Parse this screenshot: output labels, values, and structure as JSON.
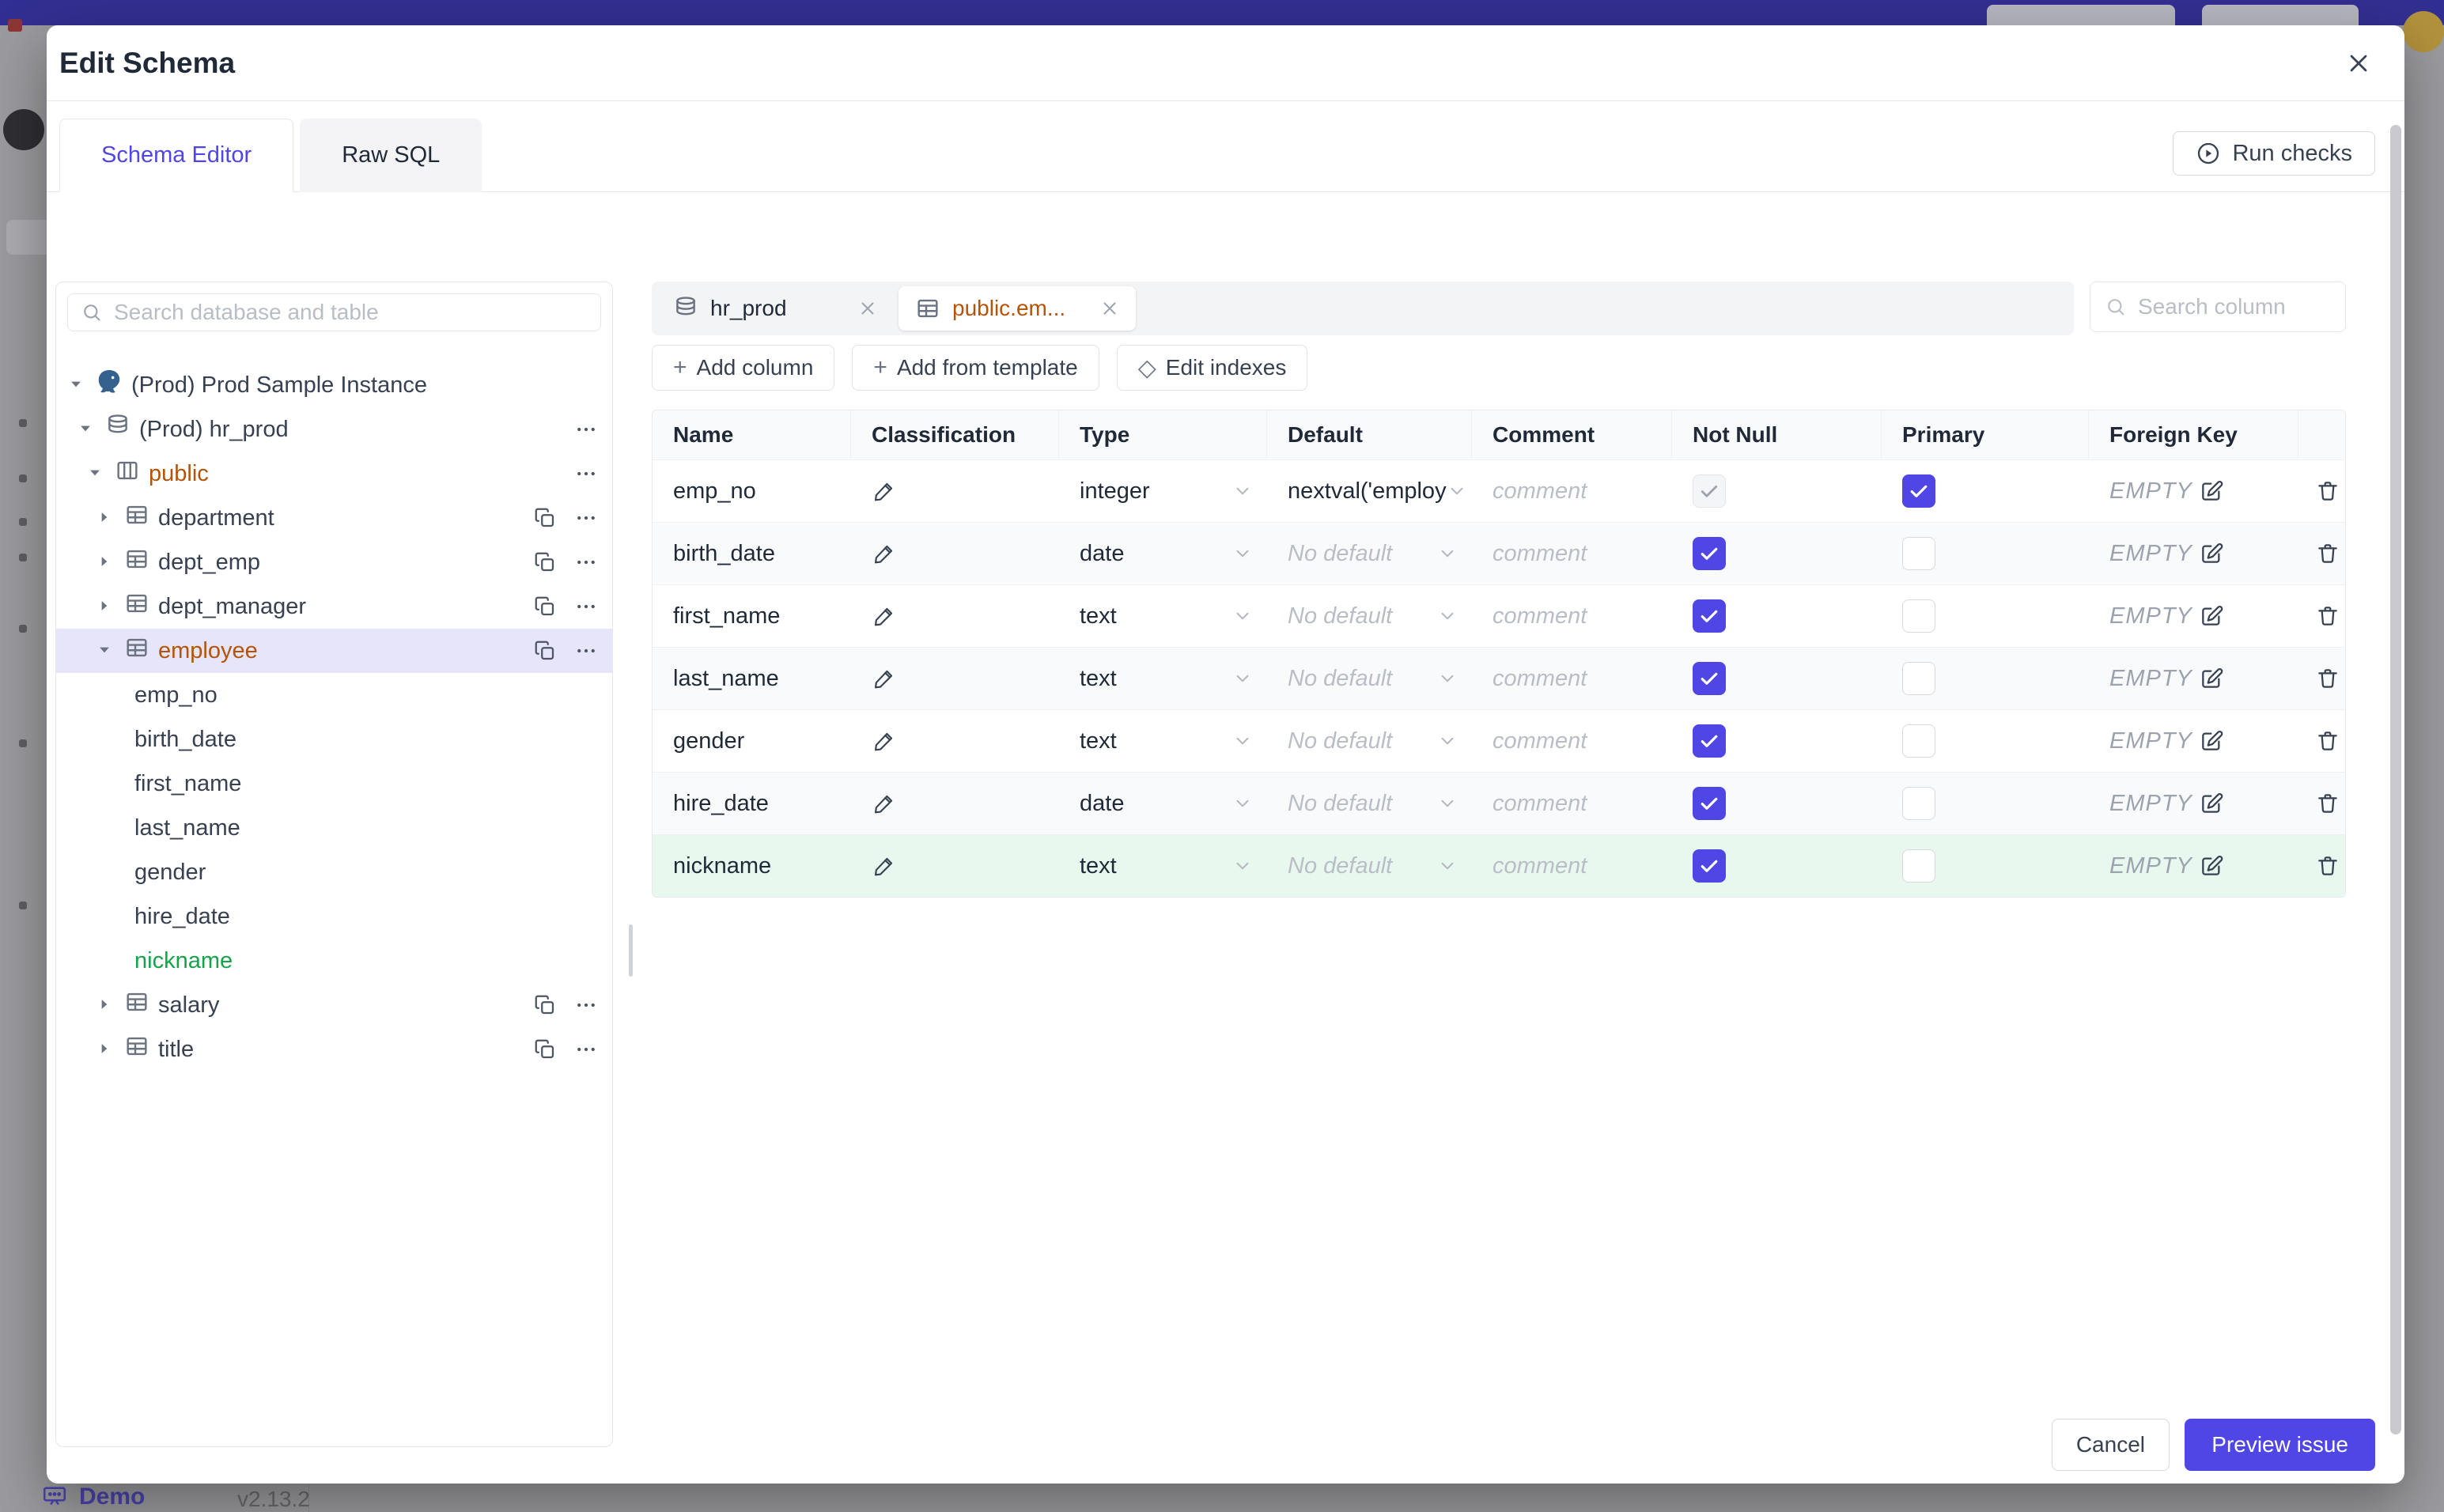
{
  "colors": {
    "accent": "#4f46e5",
    "orange": "#b45309",
    "green": "#16a34a",
    "topbar": "#322f92"
  },
  "backdrop": {
    "demo_label": "Demo",
    "version": "v2.13.2"
  },
  "modal": {
    "title": "Edit Schema",
    "run_checks": "Run checks",
    "tabs": [
      {
        "label": "Schema Editor",
        "active": true
      },
      {
        "label": "Raw SQL",
        "active": false
      }
    ],
    "cancel": "Cancel",
    "preview_issue": "Preview issue"
  },
  "sidebar": {
    "search_placeholder": "Search database and table",
    "tree": [
      {
        "label": "(Prod) Prod Sample Instance",
        "level": 0,
        "icon": "postgres",
        "expanded": true,
        "actions": []
      },
      {
        "label": "(Prod) hr_prod",
        "level": 1,
        "icon": "database",
        "expanded": true,
        "actions": [
          "more"
        ]
      },
      {
        "label": "public",
        "level": 2,
        "icon": "schema",
        "expanded": true,
        "accent": "orange",
        "actions": [
          "more"
        ]
      },
      {
        "label": "department",
        "level": 3,
        "icon": "table",
        "expanded": false,
        "actions": [
          "copy",
          "more"
        ]
      },
      {
        "label": "dept_emp",
        "level": 3,
        "icon": "table",
        "expanded": false,
        "actions": [
          "copy",
          "more"
        ]
      },
      {
        "label": "dept_manager",
        "level": 3,
        "icon": "table",
        "expanded": false,
        "actions": [
          "copy",
          "more"
        ]
      },
      {
        "label": "employee",
        "level": 3,
        "icon": "table",
        "expanded": true,
        "accent": "orange",
        "selected": true,
        "actions": [
          "copy",
          "more"
        ]
      },
      {
        "label": "emp_no",
        "level": 4,
        "column": true
      },
      {
        "label": "birth_date",
        "level": 4,
        "column": true
      },
      {
        "label": "first_name",
        "level": 4,
        "column": true
      },
      {
        "label": "last_name",
        "level": 4,
        "column": true
      },
      {
        "label": "gender",
        "level": 4,
        "column": true
      },
      {
        "label": "hire_date",
        "level": 4,
        "column": true
      },
      {
        "label": "nickname",
        "level": 4,
        "column": true,
        "accent": "green"
      },
      {
        "label": "salary",
        "level": 3,
        "icon": "table",
        "expanded": false,
        "actions": [
          "copy",
          "more"
        ]
      },
      {
        "label": "title",
        "level": 3,
        "icon": "table",
        "expanded": false,
        "actions": [
          "copy",
          "more"
        ]
      }
    ]
  },
  "editor": {
    "chips": [
      {
        "label": "hr_prod",
        "icon": "database",
        "active": false
      },
      {
        "label": "public.em...",
        "icon": "table",
        "active": true
      }
    ],
    "column_search_placeholder": "Search column",
    "toolbar": [
      {
        "symbol": "+",
        "label": "Add column"
      },
      {
        "symbol": "+",
        "label": "Add from template"
      },
      {
        "symbol": "◇",
        "label": "Edit indexes"
      }
    ],
    "table": {
      "headers": [
        "Name",
        "Classification",
        "Type",
        "Default",
        "Comment",
        "Not Null",
        "Primary",
        "Foreign Key",
        ""
      ],
      "comment_placeholder": "comment",
      "fk_value": "EMPTY",
      "rows": [
        {
          "name": "emp_no",
          "type": "integer",
          "default": "nextval('employ",
          "has_default": true,
          "not_null": "disabled-checked",
          "primary": true,
          "new": false,
          "stripe": false
        },
        {
          "name": "birth_date",
          "type": "date",
          "default": "No default",
          "has_default": false,
          "not_null": "checked",
          "primary": false,
          "new": false,
          "stripe": true
        },
        {
          "name": "first_name",
          "type": "text",
          "default": "No default",
          "has_default": false,
          "not_null": "checked",
          "primary": false,
          "new": false,
          "stripe": false
        },
        {
          "name": "last_name",
          "type": "text",
          "default": "No default",
          "has_default": false,
          "not_null": "checked",
          "primary": false,
          "new": false,
          "stripe": true
        },
        {
          "name": "gender",
          "type": "text",
          "default": "No default",
          "has_default": false,
          "not_null": "checked",
          "primary": false,
          "new": false,
          "stripe": false
        },
        {
          "name": "hire_date",
          "type": "date",
          "default": "No default",
          "has_default": false,
          "not_null": "checked",
          "primary": false,
          "new": false,
          "stripe": true
        },
        {
          "name": "nickname",
          "type": "text",
          "default": "No default",
          "has_default": false,
          "not_null": "checked",
          "primary": false,
          "new": true,
          "stripe": false
        }
      ]
    }
  }
}
